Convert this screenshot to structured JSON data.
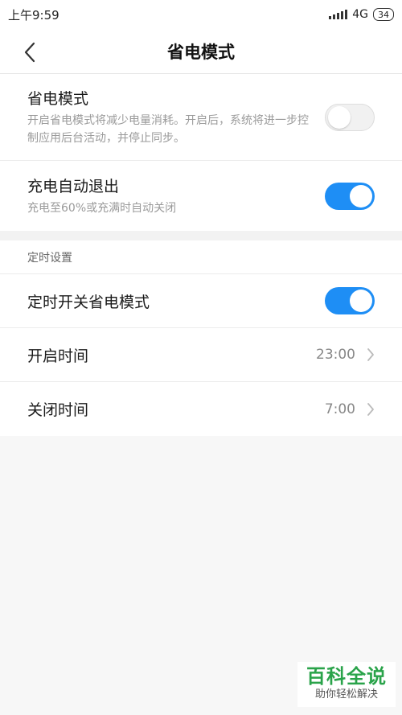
{
  "status_bar": {
    "time": "上午9:59",
    "network": "4G",
    "battery": "34"
  },
  "header": {
    "title": "省电模式"
  },
  "power_saving": {
    "title": "省电模式",
    "description": "开启省电模式将减少电量消耗。开启后，系统将进一步控制应用后台活动，并停止同步。",
    "enabled": false
  },
  "auto_exit": {
    "title": "充电自动退出",
    "description": "充电至60%或充满时自动关闭",
    "enabled": true
  },
  "schedule": {
    "section_label": "定时设置",
    "toggle_title": "定时开关省电模式",
    "enabled": true,
    "start": {
      "label": "开启时间",
      "value": "23:00"
    },
    "end": {
      "label": "关闭时间",
      "value": "7:00"
    }
  },
  "watermark": {
    "logo": "百科全说",
    "slogan": "助你轻松解决"
  },
  "colors": {
    "accent": "#1e8ef5",
    "watermark_green": "#2aa34a"
  }
}
